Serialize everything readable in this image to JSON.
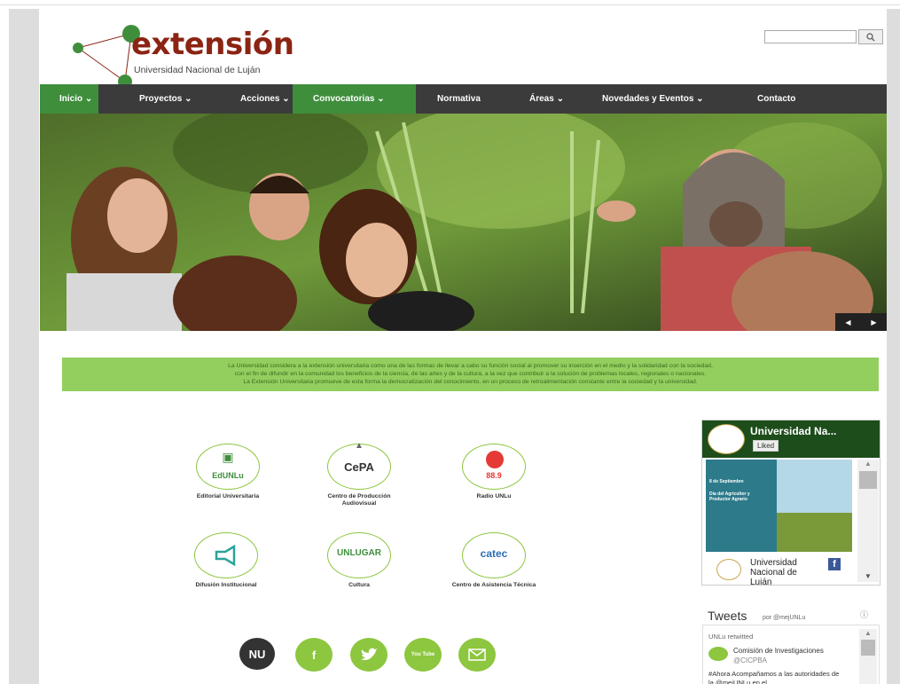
{
  "logo": {
    "word": "extensión",
    "subtitle": "Universidad Nacional de Luján"
  },
  "search": {
    "placeholder": "",
    "button_icon": "search-icon"
  },
  "nav": [
    {
      "label": "Inicio ⌄",
      "active": true
    },
    {
      "label": "Proyectos ⌄",
      "active": false
    },
    {
      "label": "Acciones ⌄",
      "active": false
    },
    {
      "label": "Convocatorias ⌄",
      "active": true
    },
    {
      "label": "Normativa",
      "active": false
    },
    {
      "label": "Áreas ⌄",
      "active": false
    },
    {
      "label": "Novedades y Eventos ⌄",
      "active": false
    },
    {
      "label": "Contacto",
      "active": false
    }
  ],
  "hero": {
    "prev": "◀",
    "next": "▶"
  },
  "banner": {
    "line1": "La Universidad considera a la extensión universitaria como una de las formas de llevar a cabo su función social al promover su inserción en el medio y la solidaridad con la sociedad,",
    "line2": "con el fin de difundir en la comunidad los beneficios de la ciencia, de las artes y de la cultura, a la vez que contribuir a la solución de problemas locales, regionales o nacionales.",
    "line3": "La Extensión Universitaria promueve de esta forma la democratización del conocimiento, en un proceso de retroalimentación constante entre la sociedad y la universidad."
  },
  "cards": [
    {
      "label": "Editorial Universitaria",
      "logo_text": "EdUNLu"
    },
    {
      "label": "Centro de Producción Audiovisual",
      "logo_text": "CePA"
    },
    {
      "label": "Radio UNLu",
      "logo_text": "88.9"
    },
    {
      "label": "Difusión Institucional",
      "logo_text": ""
    },
    {
      "label": "Cultura",
      "logo_text": "UNLUGAR"
    },
    {
      "label": "Centro de Asistencia Técnica",
      "logo_text": "catec"
    }
  ],
  "social": {
    "nu": "NU",
    "facebook": "f",
    "youtube": "You Tube"
  },
  "facebook_widget": {
    "title": "Universidad Na...",
    "like": "Liked",
    "post_date": "8 de Septiembre",
    "post_title": "Día del Agricultor y Productor Agrario",
    "foot_name": "Universidad Nacional de Luján"
  },
  "twitter": {
    "title": "Tweets",
    "by": "por @mejUNLu",
    "retweet": "UNLu retwitted",
    "account_name": "Comisión de Investigaciones",
    "account_handle": "@CICPBA",
    "text": "#Ahora Acompañamos a las autoridades de la @mejUNLu en el"
  }
}
